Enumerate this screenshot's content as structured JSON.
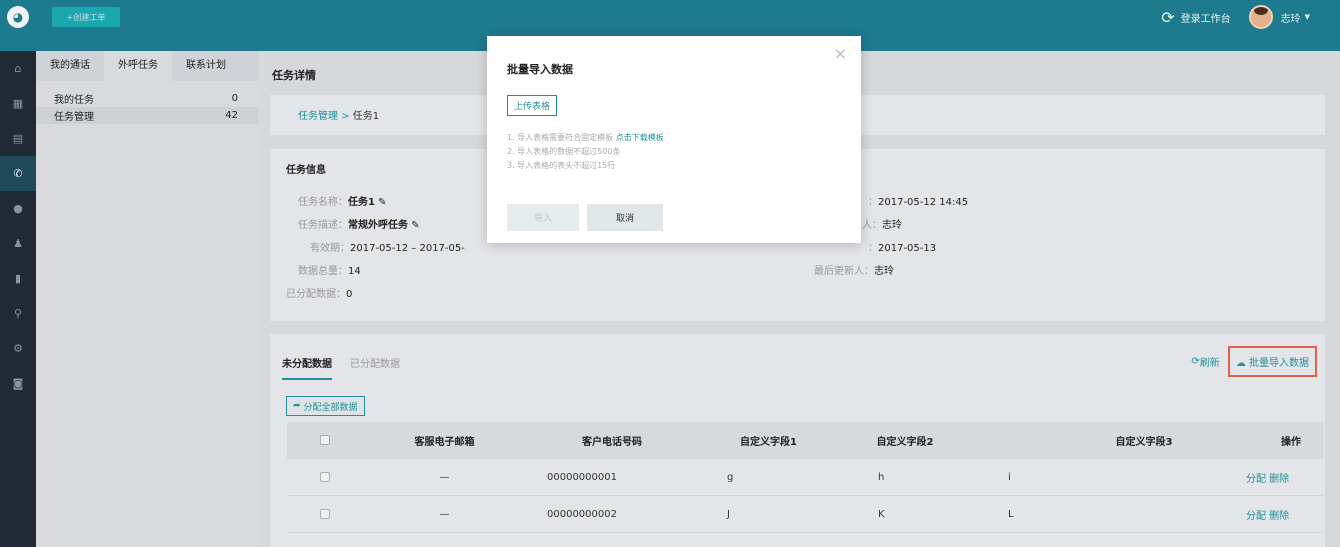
{
  "topbar": {
    "create_label": "+创建工单",
    "workspace_label": "登录工作台",
    "user_name": "志玲"
  },
  "subnav": {
    "tabs": [
      "我的通话",
      "外呼任务",
      "联系计划"
    ],
    "items": [
      {
        "label": "我的任务",
        "count": "0"
      },
      {
        "label": "任务管理",
        "count": "42"
      }
    ]
  },
  "main": {
    "page_title": "任务详情",
    "breadcrumb": {
      "root": "任务管理 >",
      "current": "任务1"
    },
    "info": {
      "title": "任务信息",
      "name_label": "任务名称：",
      "name_value": "任务1",
      "desc_label": "任务描述：",
      "desc_value": "常规外呼任务",
      "valid_label": "有效期：",
      "valid_value": "2017-05-12 – 2017-05-",
      "total_label": "数据总量：",
      "total_value": "14",
      "assigned_label": "已分配数据：",
      "assigned_value": "0",
      "created_suffix": "：",
      "created_value": "2017-05-12 14:45",
      "creator_suffix": "人：",
      "creator_value": "志玲",
      "updated_suffix": "：",
      "updated_value": "2017-05-13",
      "updater_label": "最后更新人：",
      "updater_value": "志玲"
    },
    "data": {
      "tab_unassigned": "未分配数据",
      "tab_assigned": "已分配数据",
      "refresh_label": "刷新",
      "import_label": "批量导入数据",
      "assign_all_label": "分配全部数据",
      "columns": [
        "客服电子邮箱",
        "客户电话号码",
        "自定义字段1",
        "自定义字段2",
        "自定义字段3",
        "操作"
      ],
      "rows": [
        {
          "email": "—",
          "phone": "00000000001",
          "f1": "g",
          "f2": "h",
          "f3": "i",
          "ops": "分配 删除"
        },
        {
          "email": "—",
          "phone": "00000000002",
          "f1": "J",
          "f2": "K",
          "f3": "L",
          "ops": "分配 删除"
        }
      ]
    }
  },
  "modal": {
    "title": "批量导入数据",
    "close": "×",
    "upload_label": "上传表格",
    "tip1": "1. 导入表格需要符合固定模板",
    "tip1_link": "点击下载模板",
    "tip2": "2. 导入表格的数据不超过500条",
    "tip3": "3. 导入表格的表头不超过15行",
    "import_label": "导入",
    "cancel_label": "取消"
  }
}
